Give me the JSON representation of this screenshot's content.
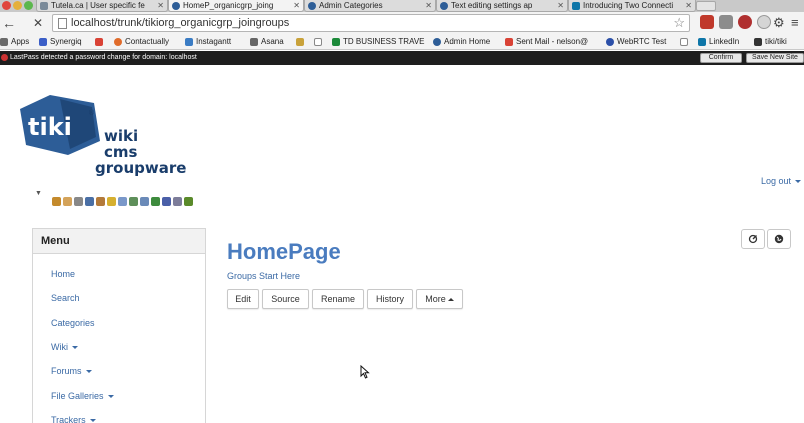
{
  "browser": {
    "tabs": [
      {
        "label": "Tutela.ca | User specific fe",
        "active": false
      },
      {
        "label": "HomeP_organicgrp_joing",
        "active": true
      },
      {
        "label": "Admin Categories",
        "active": false
      },
      {
        "label": "Text editing settings ap",
        "active": false
      },
      {
        "label": "Introducing Two Connecti",
        "active": false
      }
    ],
    "url": "localhost/trunk/tikiorg_organicgrp_joingroups",
    "bookmarks": [
      {
        "label": "Apps",
        "icon": "apps-grid-icon"
      },
      {
        "label": "Synergiq",
        "icon": "synergiq-icon"
      },
      {
        "label": "",
        "icon": "gmail-icon"
      },
      {
        "label": "Contactually",
        "icon": "contactually-icon"
      },
      {
        "label": "Instagantt",
        "icon": "instagantt-icon"
      },
      {
        "label": "Asana",
        "icon": "asana-icon"
      },
      {
        "label": "",
        "icon": "page-icon"
      },
      {
        "label": "TD BUSINESS TRAVE",
        "icon": "td-icon"
      },
      {
        "label": "Admin Home",
        "icon": "tiki-icon"
      },
      {
        "label": "Sent Mail - nelson@",
        "icon": "gmail-icon"
      },
      {
        "label": "WebRTC Test",
        "icon": "webrtc-icon"
      },
      {
        "label": "",
        "icon": "page-icon"
      },
      {
        "label": "LinkedIn",
        "icon": "linkedin-icon"
      },
      {
        "label": "tiki/tiki",
        "icon": "tiki-icon"
      }
    ]
  },
  "lastpass": {
    "message": "LastPass detected a password change for domain: localhost",
    "confirm_label": "Confirm",
    "save_label": "Save New Site"
  },
  "site": {
    "logo_lines": [
      "wiki",
      "cms",
      "groupware"
    ],
    "logo_mark_text": "tiki",
    "logout_label": "Log out"
  },
  "menu": {
    "title": "Menu",
    "items": [
      {
        "label": "Home",
        "dropdown": false
      },
      {
        "label": "Search",
        "dropdown": false
      },
      {
        "label": "Categories",
        "dropdown": false
      },
      {
        "label": "Wiki",
        "dropdown": true
      },
      {
        "label": "Forums",
        "dropdown": true
      },
      {
        "label": "File Galleries",
        "dropdown": true
      },
      {
        "label": "Trackers",
        "dropdown": true
      }
    ]
  },
  "page": {
    "title": "HomePage",
    "description": "Groups Start Here",
    "actions": [
      "Edit",
      "Source",
      "Rename",
      "History",
      "More"
    ]
  },
  "colors": {
    "link": "#3b6aa5",
    "title": "#4a7cbf",
    "logo": "#1a3d6b"
  }
}
